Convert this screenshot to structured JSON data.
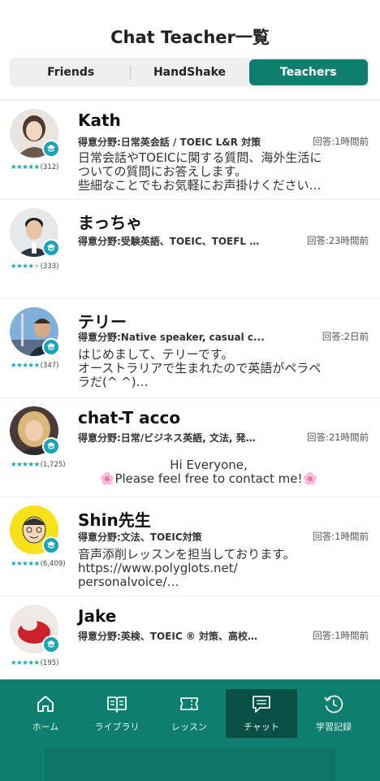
{
  "header": {
    "title": "Chat Teacher一覧",
    "tabs": [
      {
        "label": "Friends",
        "active": false
      },
      {
        "label": "HandShake",
        "active": false
      },
      {
        "label": "Teachers",
        "active": true
      }
    ]
  },
  "accent_color": "#0e7e6e",
  "teachers": [
    {
      "name": "Kath",
      "field": "得意分野:日常英会話 / TOEIC L&R 対策",
      "answered": "回答:1時間前",
      "rating": 5,
      "reviews": "(312)",
      "bio": "日常会話やTOEICに関する質問、海外生活に\nついての質問にお答えします。\n些細なことでもお気軽にお声掛けください…"
    },
    {
      "name": "まっちゃ",
      "field": "得意分野:受験英語、TOEIC、TOEFL …",
      "answered": "回答:23時間前",
      "rating": 4,
      "reviews": "(333)",
      "bio": ""
    },
    {
      "name": "テリー",
      "field": "得意分野:Native speaker, casual c...",
      "answered": "回答:2日前",
      "rating": 5,
      "reviews": "(347)",
      "bio": "はじめまして、テリーです。\nオーストラリアで生まれたので英語がペラペ\nラだ(^ ^)…"
    },
    {
      "name": "chat-T acco",
      "field": "得意分野:日常/ビジネス英語, 文法, 発…",
      "answered": "回答:21時間前",
      "rating": 5,
      "reviews": "(1,725)",
      "bio": "Hi Everyone,\n🌸Please feel free to contact me!🌸"
    },
    {
      "name": "Shin先生",
      "field": "得意分野:文法、TOEIC対策",
      "answered": "回答:1時間前",
      "rating": 5,
      "reviews": "(6,409)",
      "bio": "音声添削レッスンを担当しております。\nhttps://www.polyglots.net/\npersonalvoice/…"
    },
    {
      "name": "Jake",
      "field": "得意分野:英検、TOEIC ® 対策、高校…",
      "answered": "回答:1時間前",
      "rating": 5,
      "reviews": "(195)",
      "bio": ""
    }
  ],
  "tabbar": [
    {
      "label": "ホーム",
      "icon": "home-icon",
      "active": false
    },
    {
      "label": "ライブラリ",
      "icon": "book-icon",
      "active": false
    },
    {
      "label": "レッスン",
      "icon": "ticket-icon",
      "active": false
    },
    {
      "label": "チャット",
      "icon": "chat-icon",
      "active": true
    },
    {
      "label": "学習記録",
      "icon": "history-icon",
      "active": false
    }
  ]
}
